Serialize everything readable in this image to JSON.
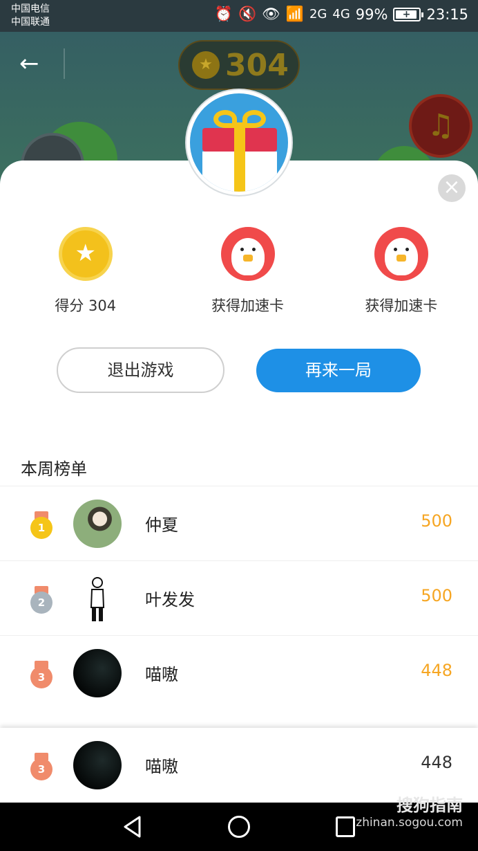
{
  "status_bar": {
    "carrier_1": "中国电信",
    "carrier_2": "中国联通",
    "signal_2g": "2G",
    "signal_4g": "4G",
    "battery_percent": "99%",
    "time": "23:15"
  },
  "game": {
    "score": "304"
  },
  "result_sheet": {
    "rewards": [
      {
        "icon": "star-coin-icon",
        "label": "得分 304"
      },
      {
        "icon": "chick-card-icon",
        "label": "获得加速卡"
      },
      {
        "icon": "chick-card-icon",
        "label": "获得加速卡"
      }
    ],
    "exit_label": "退出游戏",
    "again_label": "再来一局"
  },
  "leaderboard": {
    "title": "本周榜单",
    "rows": [
      {
        "rank": "1",
        "name": "仲夏",
        "score": "500",
        "medal_color": "#f5c518"
      },
      {
        "rank": "2",
        "name": "叶发发",
        "score": "500",
        "medal_color": "#a9b4bd"
      },
      {
        "rank": "3",
        "name": "喵嗷",
        "score": "448",
        "medal_color": "#f08b6b"
      }
    ],
    "my_rank": {
      "rank": "3",
      "name": "喵嗷",
      "score": "448"
    }
  },
  "watermark": {
    "brand": "搜狗指南",
    "url": "zhinan.sogou.com"
  },
  "colors": {
    "accent_blue": "#1e90e6",
    "score_orange": "#f6a623"
  }
}
